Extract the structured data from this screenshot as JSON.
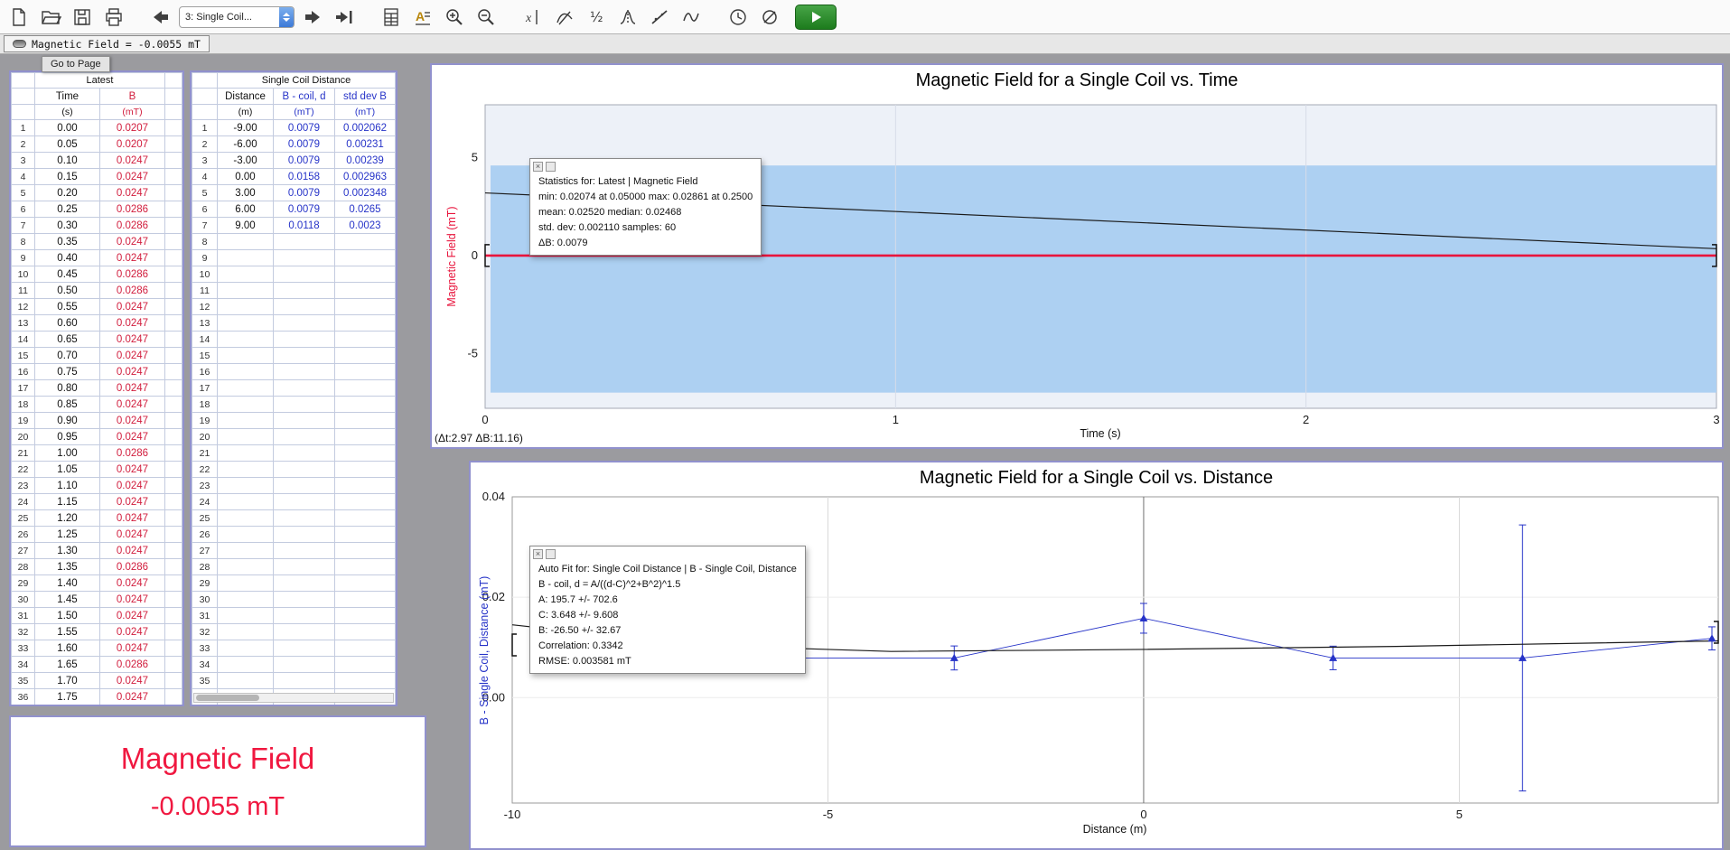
{
  "toolbar": {
    "page_dropdown": "3: Single Coil...",
    "icons": [
      "new-document",
      "open-file",
      "save",
      "print",
      "back-arrow",
      "page-dropdown",
      "forward-arrow",
      "skip-to-end",
      "data-browser",
      "text-annotation",
      "zoom-in",
      "zoom-out",
      "examine",
      "tangent",
      "interpolate-half",
      "statistics",
      "linear-fit",
      "curve-fit",
      "data-collection-timing",
      "zero",
      "collect"
    ]
  },
  "readout": {
    "text": "Magnetic Field = -0.0055 mT"
  },
  "go_to_page": "Go to Page",
  "latest_table": {
    "title": "Latest",
    "col1": {
      "name": "Time",
      "unit": "(s)"
    },
    "col2": {
      "name": "B",
      "unit": "(mT)"
    },
    "rows": [
      [
        "0.00",
        "0.0207"
      ],
      [
        "0.05",
        "0.0207"
      ],
      [
        "0.10",
        "0.0247"
      ],
      [
        "0.15",
        "0.0247"
      ],
      [
        "0.20",
        "0.0247"
      ],
      [
        "0.25",
        "0.0286"
      ],
      [
        "0.30",
        "0.0286"
      ],
      [
        "0.35",
        "0.0247"
      ],
      [
        "0.40",
        "0.0247"
      ],
      [
        "0.45",
        "0.0286"
      ],
      [
        "0.50",
        "0.0286"
      ],
      [
        "0.55",
        "0.0247"
      ],
      [
        "0.60",
        "0.0247"
      ],
      [
        "0.65",
        "0.0247"
      ],
      [
        "0.70",
        "0.0247"
      ],
      [
        "0.75",
        "0.0247"
      ],
      [
        "0.80",
        "0.0247"
      ],
      [
        "0.85",
        "0.0247"
      ],
      [
        "0.90",
        "0.0247"
      ],
      [
        "0.95",
        "0.0247"
      ],
      [
        "1.00",
        "0.0286"
      ],
      [
        "1.05",
        "0.0247"
      ],
      [
        "1.10",
        "0.0247"
      ],
      [
        "1.15",
        "0.0247"
      ],
      [
        "1.20",
        "0.0247"
      ],
      [
        "1.25",
        "0.0247"
      ],
      [
        "1.30",
        "0.0247"
      ],
      [
        "1.35",
        "0.0286"
      ],
      [
        "1.40",
        "0.0247"
      ],
      [
        "1.45",
        "0.0247"
      ],
      [
        "1.50",
        "0.0247"
      ],
      [
        "1.55",
        "0.0247"
      ],
      [
        "1.60",
        "0.0247"
      ],
      [
        "1.65",
        "0.0286"
      ],
      [
        "1.70",
        "0.0247"
      ],
      [
        "1.75",
        "0.0247"
      ]
    ]
  },
  "distance_table": {
    "title": "Single Coil Distance",
    "col1": {
      "name": "Distance",
      "unit": "(m)"
    },
    "col2": {
      "name": "B - coil, d",
      "unit": "(mT)"
    },
    "col3": {
      "name": "std dev B",
      "unit": "(mT)"
    },
    "rows": [
      [
        "-9.00",
        "0.0079",
        "0.002062"
      ],
      [
        "-6.00",
        "0.0079",
        "0.00231"
      ],
      [
        "-3.00",
        "0.0079",
        "0.00239"
      ],
      [
        "0.00",
        "0.0158",
        "0.002963"
      ],
      [
        "3.00",
        "0.0079",
        "0.002348"
      ],
      [
        "6.00",
        "0.0079",
        "0.0265"
      ],
      [
        "9.00",
        "0.0118",
        "0.0023"
      ]
    ],
    "total_rows": 36
  },
  "meter": {
    "title": "Magnetic Field",
    "value": "-0.0055 mT"
  },
  "chart_data": [
    {
      "type": "line",
      "title": "Magnetic Field for a Single Coil vs. Time",
      "xlabel": "Time (s)",
      "ylabel": "Magnetic Field (mT)",
      "ylabel_color": "#e8143c",
      "xlim": [
        0,
        3
      ],
      "ylim": [
        -7.8,
        7.7
      ],
      "xticks": [
        0,
        1,
        2,
        3
      ],
      "yticks": [
        5,
        0,
        -5
      ],
      "grid": true,
      "band": {
        "y_from": -7.0,
        "y_to": 4.6,
        "color": "#add0f2"
      },
      "series": [
        {
          "name": "magnetic-field-baseline",
          "color": "#e8143c",
          "width": 2.6,
          "points": [
            [
              0,
              0
            ],
            [
              3,
              0
            ]
          ]
        },
        {
          "name": "trend-line",
          "color": "#1a1a1a",
          "width": 1.2,
          "points": [
            [
              0,
              3.2
            ],
            [
              3,
              0.35
            ]
          ]
        }
      ],
      "brackets": [
        {
          "x": 0,
          "y": 0,
          "side": "left"
        },
        {
          "x": 3,
          "y": 0,
          "side": "right"
        }
      ],
      "corner_label": "(Δt:2.97 ΔB:11.16)",
      "overlay_box": {
        "lines": [
          "Statistics for: Latest | Magnetic Field",
          "min: 0.02074 at 0.05000 max: 0.02861 at 0.2500",
          "mean: 0.02520 median: 0.02468",
          "std. dev: 0.002110 samples: 60",
          "ΔB: 0.0079"
        ]
      }
    },
    {
      "type": "scatter",
      "title": "Magnetic Field for a Single Coil vs. Distance",
      "xlabel": "Distance (m)",
      "ylabel": "B - Single Coil, Distance (mT)",
      "ylabel_color": "#2633c8",
      "xlim": [
        -10,
        9.1
      ],
      "ylim": [
        -0.021,
        0.04
      ],
      "xticks": [
        -10,
        -5,
        0,
        5
      ],
      "yticks": [
        0,
        0.02,
        0.04
      ],
      "ytick_labels": [
        "0.00",
        "0.02",
        "0.04"
      ],
      "grid": true,
      "marker_color": "#2633c8",
      "points": [
        {
          "x": -9,
          "y": 0.0079,
          "err": 0.002062
        },
        {
          "x": -6,
          "y": 0.0079,
          "err": 0.00231
        },
        {
          "x": -3,
          "y": 0.0079,
          "err": 0.00239
        },
        {
          "x": 0,
          "y": 0.0158,
          "err": 0.002963
        },
        {
          "x": 3,
          "y": 0.0079,
          "err": 0.002348
        },
        {
          "x": 6,
          "y": 0.0079,
          "err": 0.0265
        },
        {
          "x": 9,
          "y": 0.0118,
          "err": 0.0023
        }
      ],
      "fit_line": {
        "color": "#1a1a1a",
        "points": [
          [
            -10,
            0.0145
          ],
          [
            -7,
            0.0104
          ],
          [
            -4,
            0.0092
          ],
          [
            0,
            0.0096
          ],
          [
            4,
            0.0102
          ],
          [
            9.1,
            0.0113
          ]
        ]
      },
      "brackets": [
        {
          "x": -10,
          "y": 0.0105,
          "side": "left"
        },
        {
          "x": 9.1,
          "y": 0.013,
          "side": "right"
        }
      ],
      "overlay_box": {
        "lines": [
          "Auto Fit for: Single Coil Distance | B - Single Coil, Distance",
          "B - coil, d = A/((d-C)^2+B^2)^1.5",
          "A: 195.7 +/- 702.6",
          "C: 3.648 +/- 9.608",
          "B: -26.50 +/- 32.67",
          "Correlation: 0.3342",
          "RMSE: 0.003581 mT"
        ]
      }
    }
  ]
}
